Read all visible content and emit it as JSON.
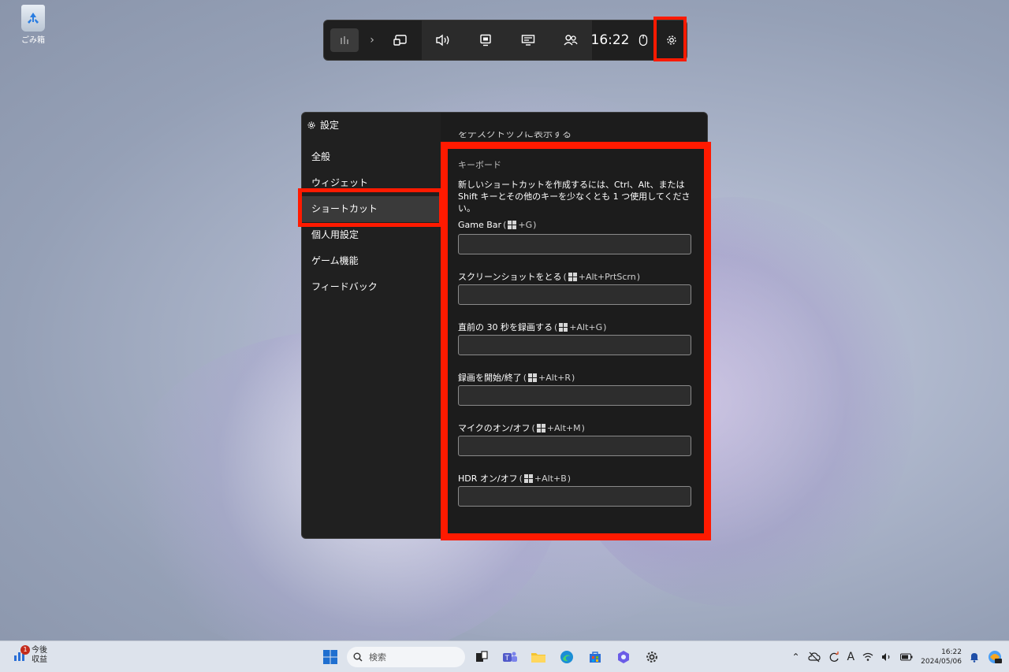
{
  "desktop": {
    "recycle_bin_label": "ごみ箱"
  },
  "gamebar": {
    "time": "16:22",
    "icons": [
      "home-widget-icon",
      "chevron-right-icon",
      "capture-icon",
      "audio-icon",
      "performance-icon",
      "resources-icon",
      "xbox-social-icon",
      "mouse-icon",
      "gear-icon"
    ]
  },
  "settings": {
    "title": "設定",
    "nav": [
      {
        "label": "全般"
      },
      {
        "label": "ウィジェット"
      },
      {
        "label": "ショートカット",
        "active": true
      },
      {
        "label": "個人用設定"
      },
      {
        "label": "ゲーム機能"
      },
      {
        "label": "フィードバック"
      }
    ],
    "cut_text": "をデスクトップに表示する",
    "section_label": "キーボード",
    "description": "新しいショートカットを作成するには、Ctrl、Alt、または Shift キーとその他のキーを少なくとも 1 つ使用してください。",
    "shortcuts": [
      {
        "label": "Game Bar",
        "hint": "+G",
        "value": ""
      },
      {
        "label": "スクリーンショットをとる",
        "hint": "+Alt+PrtScrn",
        "value": ""
      },
      {
        "label": "直前の 30 秒を録画する",
        "hint": "+Alt+G",
        "value": ""
      },
      {
        "label": "録画を開始/終了",
        "hint": "+Alt+R",
        "value": ""
      },
      {
        "label": "マイクのオン/オフ",
        "hint": "+Alt+M",
        "value": ""
      },
      {
        "label": "HDR オン/オフ",
        "hint": "+Alt+B",
        "value": ""
      }
    ]
  },
  "taskbar": {
    "widget_badge": "1",
    "widget_line1": "今後",
    "widget_line2": "収益",
    "search_placeholder": "検索",
    "clock_time": "16:22",
    "clock_date": "2024/05/06",
    "ime_label": "A"
  },
  "colors": {
    "highlight": "#ff1a00",
    "gamebar_bg": "#1f1f1f",
    "window_bg": "#202020"
  }
}
